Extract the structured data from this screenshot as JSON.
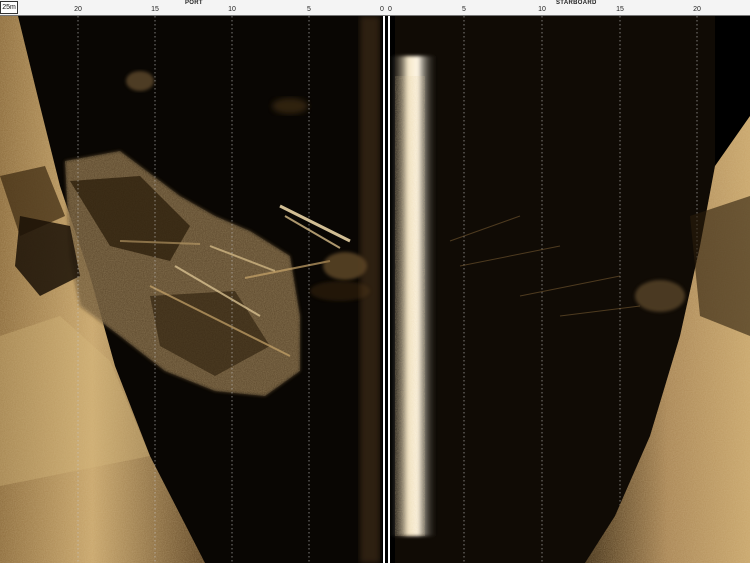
{
  "scale": {
    "range_label": "25m",
    "port_label": "PORT",
    "starboard_label": "STARBOARD",
    "port_ticks": [
      "20",
      "15",
      "10",
      "5",
      "0"
    ],
    "starboard_ticks": [
      "0",
      "5",
      "10",
      "15",
      "20"
    ]
  },
  "colors": {
    "water_column": "#000000",
    "seabed": "#b8955a",
    "seabed_dark": "#4a3418",
    "nadir_line": "#ffffff",
    "grid_line": "#c8c8c8"
  }
}
